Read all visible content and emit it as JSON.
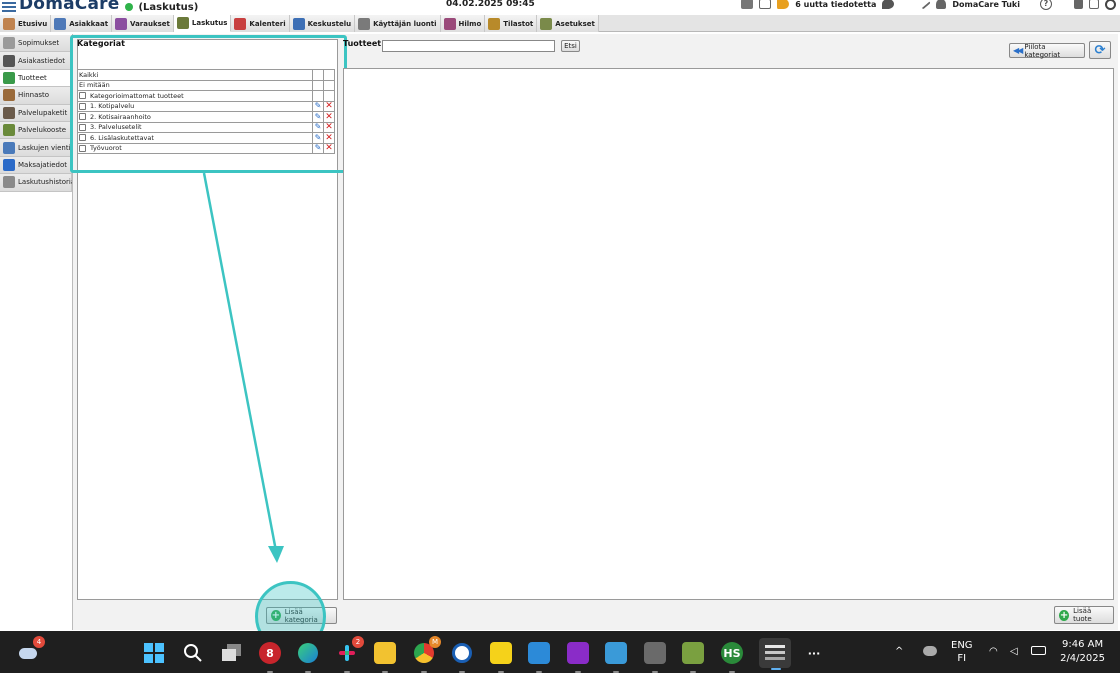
{
  "header": {
    "logo": "DomaCare",
    "context": "(Laskutus)",
    "datetime": "04.02.2025 09:45",
    "notifications": "6 uutta tiedotetta",
    "user": "DomaCare Tuki",
    "help": "?"
  },
  "nav": [
    {
      "label": "Etusivu",
      "color": "#c0834f"
    },
    {
      "label": "Asiakkaat",
      "color": "#4e79b8"
    },
    {
      "label": "Varaukset",
      "color": "#8b4fa0"
    },
    {
      "label": "Laskutus",
      "color": "#6b7a3a"
    },
    {
      "label": "Kalenteri",
      "color": "#c84040"
    },
    {
      "label": "Keskustelu",
      "color": "#3d6fb5"
    },
    {
      "label": "Käyttäjän luonti",
      "color": "#7a7a7a"
    },
    {
      "label": "Hilmo",
      "color": "#9a4a7a"
    },
    {
      "label": "Tilastot",
      "color": "#b88a2a"
    },
    {
      "label": "Asetukset",
      "color": "#7a8a4a"
    }
  ],
  "sidebar": [
    {
      "label": "Sopimukset",
      "color": "#9a9a9a"
    },
    {
      "label": "Asiakastiedot",
      "color": "#555555"
    },
    {
      "label": "Tuotteet",
      "color": "#3a9a4a"
    },
    {
      "label": "Hinnasto",
      "color": "#9a6a3a"
    },
    {
      "label": "Palvelupaketit",
      "color": "#6a5a4a"
    },
    {
      "label": "Palvelukooste",
      "color": "#6a8a3a"
    },
    {
      "label": "Laskujen vienti",
      "color": "#4a7aba"
    },
    {
      "label": "Maksajatiedot",
      "color": "#2a6ac8"
    },
    {
      "label": "Laskutushistoria",
      "color": "#8a8a8a"
    }
  ],
  "categories": {
    "title": "Kategoriat",
    "rows": [
      {
        "label": "Kaikki",
        "checkbox": false,
        "actions": false
      },
      {
        "label": "Ei mitään",
        "checkbox": false,
        "actions": false
      },
      {
        "label": "Kategorioimattomat tuotteet",
        "checkbox": true,
        "actions": false
      },
      {
        "label": "1. Kotipalvelu",
        "checkbox": true,
        "actions": true
      },
      {
        "label": "2. Kotisairaanhoito",
        "checkbox": true,
        "actions": true
      },
      {
        "label": "3. Palvelusetelit",
        "checkbox": true,
        "actions": true
      },
      {
        "label": "6. Lisälaskutettavat",
        "checkbox": true,
        "actions": true
      },
      {
        "label": "Työvuorot",
        "checkbox": true,
        "actions": true
      }
    ],
    "add_label": "Lisää kategoria"
  },
  "products": {
    "title": "Tuotteet",
    "search_value": "",
    "search_button": "Etsi",
    "hide_categories": "Piilota kategoriat",
    "add_label": "Lisää tuote"
  },
  "taskbar": {
    "weather_badge": "4",
    "slack_badge": "2",
    "chrome_badge": "M",
    "more": "···",
    "lang_top": "ENG",
    "lang_bottom": "FI",
    "time": "9:46 AM",
    "date": "2/4/2025"
  },
  "accent": "#3cc4c2"
}
